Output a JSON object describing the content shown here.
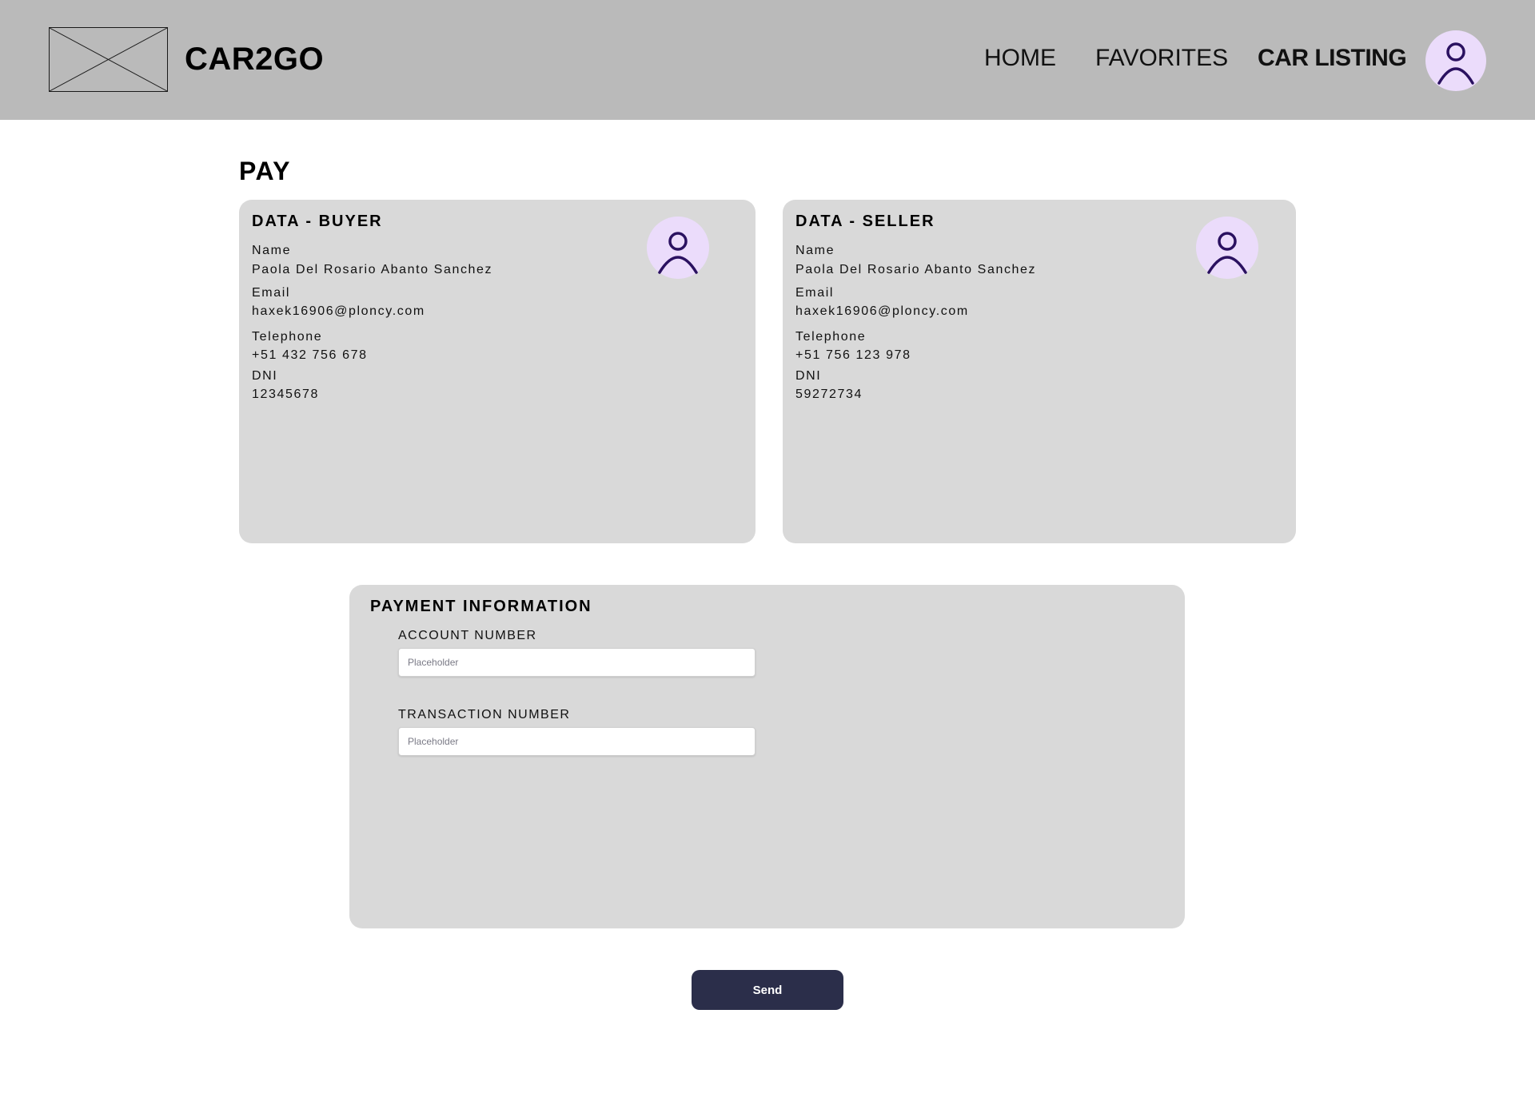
{
  "header": {
    "brand": "CAR2GO",
    "nav": {
      "home": "HOME",
      "favorites": "FAVORITES",
      "car_listing": "CAR LISTING"
    }
  },
  "page": {
    "title": "PAY"
  },
  "buyer": {
    "title": "DATA - BUYER",
    "name_label": "Name",
    "name": "Paola Del Rosario Abanto Sanchez",
    "email_label": "Email",
    "email": "haxek16906@ploncy.com",
    "telephone_label": "Telephone",
    "telephone": "+51 432 756 678",
    "dni_label": "DNI",
    "dni": "12345678"
  },
  "seller": {
    "title": "DATA - SELLER",
    "name_label": "Name",
    "name": "Paola Del Rosario Abanto Sanchez",
    "email_label": "Email",
    "email": "haxek16906@ploncy.com",
    "telephone_label": "Telephone",
    "telephone": "+51 756 123 978",
    "dni_label": "DNI",
    "dni": "59272734"
  },
  "payment": {
    "title": "PAYMENT INFORMATION",
    "account_label": "ACCOUNT NUMBER",
    "account_placeholder": "Placeholder",
    "account_value": "",
    "transaction_label": "TRANSACTION NUMBER",
    "transaction_placeholder": "Placeholder",
    "transaction_value": ""
  },
  "actions": {
    "send_label": "Send"
  },
  "colors": {
    "header_bg": "#bababa",
    "card_bg": "#d9d9d9",
    "avatar_bg": "#ebdcfb",
    "avatar_icon": "#2a1160",
    "button_bg": "#2b2e4a",
    "button_text": "#ffffff"
  },
  "icons": {
    "logo": "image-placeholder-icon",
    "avatar": "user-icon"
  }
}
